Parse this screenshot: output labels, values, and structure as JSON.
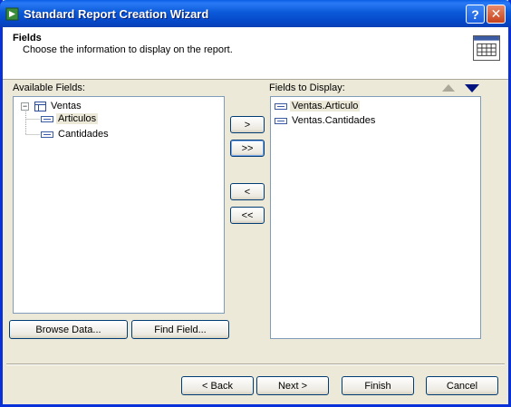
{
  "window": {
    "title": "Standard Report Creation Wizard",
    "help_label": "?",
    "close_label": "✕"
  },
  "header": {
    "title": "Fields",
    "subtitle": "Choose the information to display on the report."
  },
  "available": {
    "label": "Available Fields:",
    "table": {
      "expander": "−",
      "name": "Ventas"
    },
    "fields": [
      "Articulos",
      "Cantidades"
    ]
  },
  "display": {
    "label": "Fields to Display:",
    "fields": [
      "Ventas.Articulo",
      "Ventas.Cantidades"
    ]
  },
  "move_buttons": {
    "add": ">",
    "add_all": ">>",
    "remove": "<",
    "remove_all": "<<"
  },
  "left_buttons": {
    "browse": "Browse Data...",
    "find": "Find Field..."
  },
  "footer": {
    "back": "< Back",
    "next": "Next >",
    "finish": "Finish",
    "cancel": "Cancel"
  },
  "colors": {
    "title_bar": "#0b5ad9",
    "accent": "#00137f",
    "window_bg": "#ece9d8"
  }
}
